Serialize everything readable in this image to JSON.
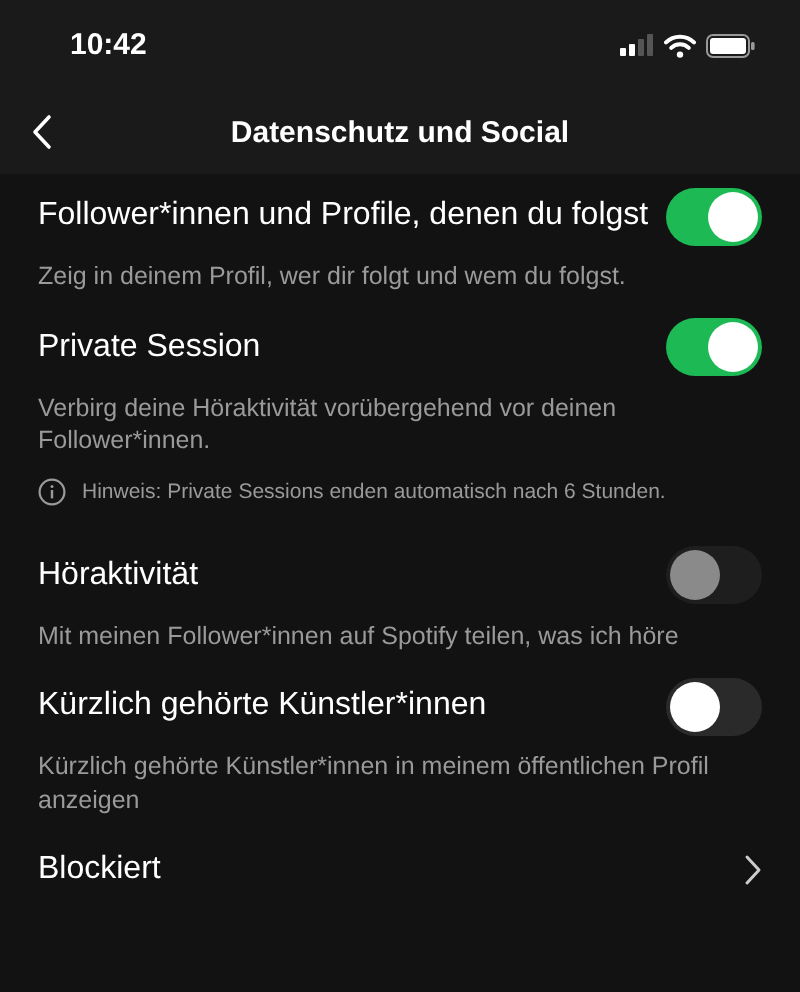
{
  "status_bar": {
    "time": "10:42"
  },
  "header": {
    "title": "Datenschutz und Social"
  },
  "items": [
    {
      "kind": "toggle",
      "label": "Follower*innen und Profile, denen du folgst",
      "description": "Zeig in deinem Profil, wer dir folgt und wem du folgst.",
      "on": true,
      "disabled": false
    },
    {
      "kind": "toggle",
      "label": "Private Session",
      "description": "Verbirg deine Höraktivität vorübergehend vor deinen Follower*innen.",
      "on": true,
      "disabled": false
    },
    {
      "kind": "hint",
      "text": "Hinweis: Private Sessions enden automatisch nach 6 Stunden."
    },
    {
      "kind": "toggle",
      "label": "Höraktivität",
      "description": "Mit meinen Follower*innen auf Spotify teilen, was ich höre",
      "on": false,
      "disabled": true
    },
    {
      "kind": "toggle",
      "label": "Kürzlich gehörte Künstler*innen",
      "description": "Kürzlich gehörte Künstler*innen in meinem öffentlichen Profil anzeigen",
      "on": false,
      "disabled": false
    },
    {
      "kind": "link",
      "label": "Blockiert"
    }
  ]
}
